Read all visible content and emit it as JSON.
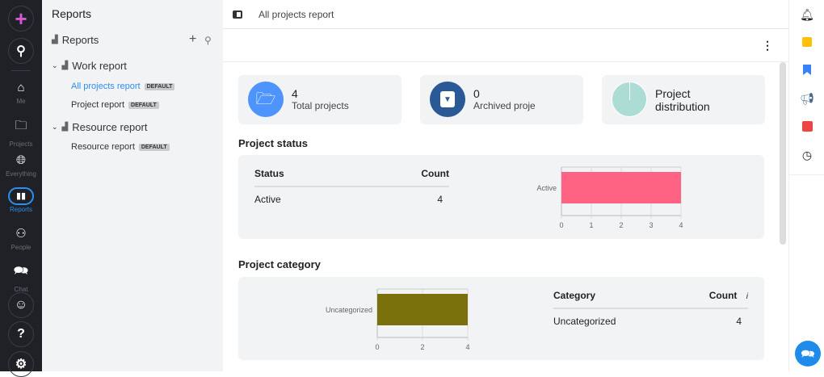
{
  "rail": {
    "items": [
      {
        "label": "Me"
      },
      {
        "label": "Projects"
      },
      {
        "label": "Everything"
      },
      {
        "label": "Reports"
      },
      {
        "label": "People"
      },
      {
        "label": "Chat"
      }
    ]
  },
  "sidebar": {
    "title": "Reports",
    "section": "Reports",
    "groups": [
      {
        "label": "Work report",
        "items": [
          {
            "label": "All projects report",
            "badge": "DEFAULT"
          },
          {
            "label": "Project report",
            "badge": "DEFAULT"
          }
        ]
      },
      {
        "label": "Resource report",
        "items": [
          {
            "label": "Resource report",
            "badge": "DEFAULT"
          }
        ]
      }
    ]
  },
  "header": {
    "breadcrumb": "All projects report"
  },
  "cards": [
    {
      "value": "4",
      "label": "Total projects"
    },
    {
      "value": "0",
      "label": "Archived projects"
    },
    {
      "label": "Project distribution"
    }
  ],
  "status": {
    "title": "Project status",
    "col1": "Status",
    "col2": "Count",
    "rows": [
      {
        "name": "Active",
        "count": "4"
      }
    ]
  },
  "category": {
    "title": "Project category",
    "col1": "Category",
    "col2": "Count",
    "info": "i",
    "rows": [
      {
        "name": "Uncategorized",
        "count": "4"
      }
    ]
  },
  "chart_data": [
    {
      "type": "bar",
      "orientation": "horizontal",
      "categories": [
        "Active"
      ],
      "values": [
        4
      ],
      "xlim": [
        0,
        4
      ],
      "ticks": [
        "0",
        "1",
        "2",
        "3",
        "4"
      ],
      "color": "#ff6384"
    },
    {
      "type": "bar",
      "orientation": "horizontal",
      "categories": [
        "Uncategorized"
      ],
      "values": [
        4
      ],
      "xlim": [
        0,
        4
      ],
      "ticks": [
        "0",
        "2",
        "4"
      ],
      "color": "#7a700c"
    }
  ]
}
